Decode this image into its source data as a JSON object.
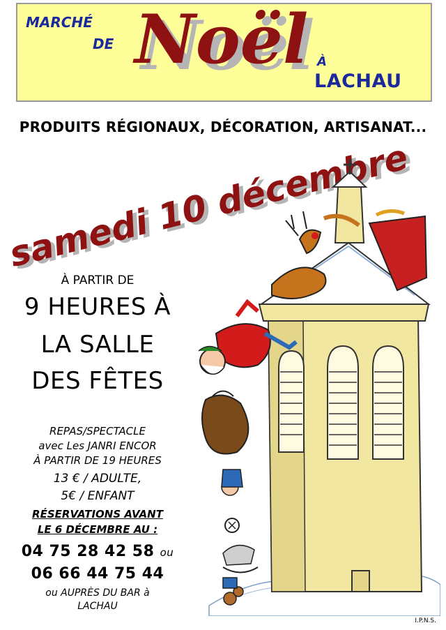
{
  "banner": {
    "marche": "MARCHÉ",
    "de": "DE",
    "noel": "Noël",
    "a": "À",
    "lachau": "LACHAU"
  },
  "subtitle": "PRODUITS RÉGIONAUX, DÉCORATION, ARTISANAT...",
  "date": "samedi 10 décembre",
  "time": {
    "partir": "À PARTIR DE",
    "line1": "9 HEURES À",
    "line2": "LA SALLE",
    "line3": "DES FÊTES"
  },
  "event": {
    "line1": "REPAS/SPECTACLE",
    "line2": "avec Les JANRI ENCOR",
    "line3": "À PARTIR DE 19 HEURES",
    "price_adult": "13 € / ADULTE,",
    "price_child": "5€ / ENFANT",
    "reservation1": "RÉSERVATIONS AVANT",
    "reservation2": "LE 6 DÉCEMBRE AU :",
    "phone1": "04 75 28 42 58",
    "ou1": "ou",
    "phone2": "06 66 44 75 44",
    "or_bar1": "ou AUPRÈS DU BAR à",
    "or_bar2": "LACHAU"
  },
  "credit": "I.P.N.S.",
  "colors": {
    "banner_bg": "#ffff99",
    "blue_text": "#1a2a9c",
    "red_title": "#8e1212",
    "tower": "#f1e7a0"
  },
  "illustration": {
    "subject": "church-bell-tower-with-santa-and-reindeer"
  }
}
